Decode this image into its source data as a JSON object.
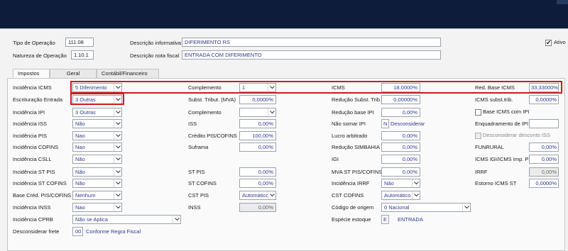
{
  "header": {
    "tipo_operacao_label": "Tipo de Operação",
    "tipo_operacao_value": "111.08",
    "natureza_operacao_label": "Natureza de Operação",
    "natureza_operacao_value": "1.10.1",
    "descricao_informativa_label": "Descrição informativa",
    "descricao_informativa_value": "DIFERIMENTO RS",
    "descricao_nota_label": "Descrição nota fiscal",
    "descricao_nota_value": "ENTRADA COM DIFERIMENTO",
    "ativo_label": "Ativo",
    "ativo_checked": true
  },
  "tabs": [
    {
      "label": "Impostos",
      "active": true
    },
    {
      "label": "Geral",
      "active": false
    },
    {
      "label": "Contábil/Financeiro",
      "active": false
    }
  ],
  "col1": {
    "incidencia_icms": {
      "label": "Incidência ICMS",
      "value": "5 Diferimento"
    },
    "escrituracao_entrada": {
      "label": "Escrituração Entrada",
      "value": "3 Outras"
    },
    "incidencia_ipi": {
      "label": "Incidência IPI",
      "value": "3 Outras"
    },
    "incidencia_iss": {
      "label": "Incidência ISS",
      "value": "Não"
    },
    "incidencia_pis": {
      "label": "Incidência PIS",
      "value": "Nao"
    },
    "incidencia_cofins": {
      "label": "Incidência COFINS",
      "value": "Nao"
    },
    "incidencia_csll": {
      "label": "Incidência CSLL",
      "value": "Não"
    },
    "incidencia_st_pis": {
      "label": "Incidência ST PIS",
      "value": "Não"
    },
    "incidencia_st_cofins": {
      "label": "Incidência ST COFINS",
      "value": "Não"
    },
    "base_cred_pis_cofins": {
      "label": "Base Créd. PIS/COFINS",
      "value": "Nenhum"
    },
    "incidencia_inss": {
      "label": "Incidência INSS",
      "value": "Nao"
    },
    "incidencia_cprb": {
      "label": "Incidência CPRB",
      "value": "Não se Aplica"
    },
    "desconsiderar_frete": {
      "label": "Desconsiderar frete",
      "code": "00",
      "text": "Conforme Regra Fiscal"
    }
  },
  "col2": {
    "complemento_1": {
      "label": "Complemento",
      "value": "1"
    },
    "subst_tribut_mva": {
      "label": "Subst. Tribut. (MVA)",
      "value": "0,0000%"
    },
    "complemento_2": {
      "label": "Complemento",
      "value": ""
    },
    "iss": {
      "label": "ISS",
      "value": "0,00%"
    },
    "credito_pis_cofins": {
      "label": "Crédito PIS/COFINS",
      "value": "100,00%"
    },
    "suframa": {
      "label": "Suframa",
      "value": "0,00%"
    },
    "st_pis": {
      "label": "ST PIS",
      "value": "0,00%"
    },
    "st_cofins": {
      "label": "ST COFINS",
      "value": "0,00%"
    },
    "cst_pis": {
      "label": "CST PIS",
      "value": "Automático"
    },
    "inss": {
      "label": "INSS",
      "value": "0,00%"
    }
  },
  "col3": {
    "icms": {
      "label": "ICMS",
      "value": "18,0000%"
    },
    "reducao_subst_trib": {
      "label": "Redução Subst. Trib.",
      "value": "0,00000%"
    },
    "reducao_base_ipi": {
      "label": "Redução base IPI",
      "value": "0,00%"
    },
    "nao_somar_ipi": {
      "label": "Não somar IPI",
      "code": "N",
      "text": "Desconsiderar"
    },
    "lucro_arbitrado": {
      "label": "Lucro arbitrado",
      "value": "0,00%"
    },
    "reducao_simbahia": {
      "label": "Redução SIMBAHIA",
      "value": "0,00%"
    },
    "igi": {
      "label": "IGI",
      "value": "0,00%"
    },
    "mva_st_pis_cofins": {
      "label": "MVA ST PIS/COFINS",
      "value": "0,00%"
    },
    "incidencia_irrf": {
      "label": "Incidência IRRF",
      "value": "Não"
    },
    "cst_cofins": {
      "label": "CST COFINS",
      "value": "Automático"
    },
    "codigo_origem": {
      "label": "Código de origem",
      "value": "0 Nacional"
    },
    "especie_estoque": {
      "label": "Espécie estoque",
      "code": "E",
      "text": "ENTRADA"
    }
  },
  "col4": {
    "red_base_icms": {
      "label": "Red. Base ICMS",
      "value": "33,33000%"
    },
    "icms_subst_trib": {
      "label": "ICMS subst.trib.",
      "value": "0,0000%"
    },
    "base_icms_com_ipi": {
      "label": "Base ICMS com IPI",
      "checked": false
    },
    "enquadramento_ipi": {
      "label": "Enquadramento de IPI",
      "value": ""
    },
    "desconsiderar_desconto_iss": {
      "label": "Desconsiderar desconto ISS",
      "checked": false
    },
    "funrural": {
      "label": "FUNRURAL",
      "value": "0,00%"
    },
    "icms_igi_icms_imp_pr": {
      "label": "ICMS IGI/ICMS Imp. PR",
      "value": "0,00%"
    },
    "irrf": {
      "label": "IRRF",
      "value": "0,00%"
    },
    "estorno_icms_st": {
      "label": "Estorno ICMS ST",
      "value": "0,0000%"
    }
  },
  "colors": {
    "highlight": "#d01a1a",
    "titlebar": "#0c1c3a",
    "value_text": "#2e3a8c"
  }
}
